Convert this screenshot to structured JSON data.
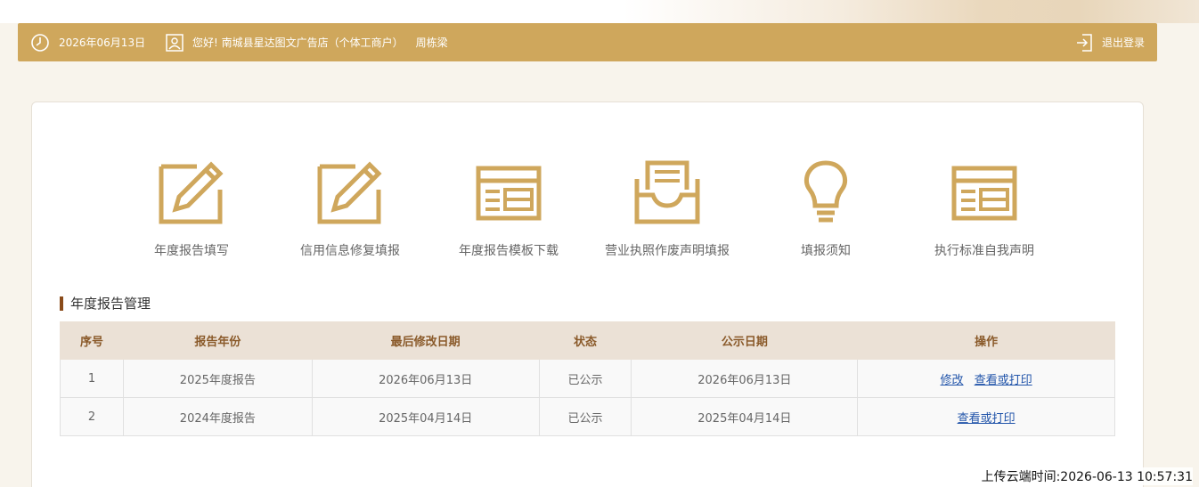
{
  "header": {
    "date": "2026年06月13日",
    "greeting": "您好! 南城县星达图文广告店（个体工商户）",
    "user_name": "周栋梁",
    "logout_label": "退出登录"
  },
  "nav": [
    {
      "label": "年度报告填写",
      "icon": "edit-pencil-icon"
    },
    {
      "label": "信用信息修复填报",
      "icon": "edit-pencil-icon"
    },
    {
      "label": "年度报告模板下载",
      "icon": "template-window-icon"
    },
    {
      "label": "营业执照作废声明填报",
      "icon": "inbox-tray-icon"
    },
    {
      "label": "填报须知",
      "icon": "lightbulb-icon"
    },
    {
      "label": "执行标准自我声明",
      "icon": "template-window-icon"
    }
  ],
  "section_title": "年度报告管理",
  "table": {
    "headers": [
      "序号",
      "报告年份",
      "最后修改日期",
      "状态",
      "公示日期",
      "操作"
    ],
    "rows": [
      {
        "index": "1",
        "year": "2025年度报告",
        "modified": "2026年06月13日",
        "status": "已公示",
        "publish": "2026年06月13日",
        "action_edit": "修改",
        "action_view": "查看或打印"
      },
      {
        "index": "2",
        "year": "2024年度报告",
        "modified": "2025年04月14日",
        "status": "已公示",
        "publish": "2025年04月14日",
        "action_view": "查看或打印"
      }
    ]
  },
  "upload_time": "上传云端时间:2026-06-13 10:57:31",
  "colors": {
    "accent": "#cfa75c",
    "icon_gold": "#cfa75c",
    "title_bar": "#8a4b1a",
    "link": "#2255aa"
  }
}
